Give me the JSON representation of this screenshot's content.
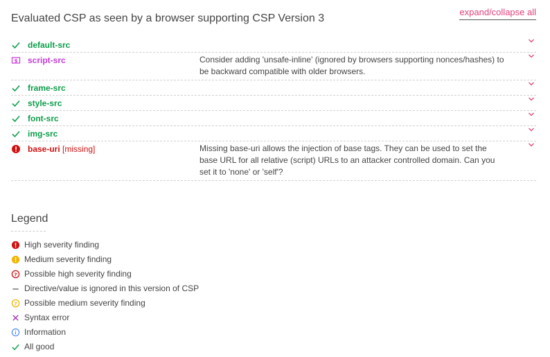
{
  "header": {
    "title": "Evaluated CSP as seen by a browser supporting CSP Version 3",
    "expand_label": "expand/collapse all"
  },
  "directives": [
    {
      "name": "default-src",
      "status": "ok",
      "missing": "",
      "description": ""
    },
    {
      "name": "script-src",
      "status": "info-purple",
      "missing": "",
      "description": "Consider adding 'unsafe-inline' (ignored by browsers supporting nonces/hashes) to be backward compatible with older browsers."
    },
    {
      "name": "frame-src",
      "status": "ok",
      "missing": "",
      "description": ""
    },
    {
      "name": "style-src",
      "status": "ok",
      "missing": "",
      "description": ""
    },
    {
      "name": "font-src",
      "status": "ok",
      "missing": "",
      "description": ""
    },
    {
      "name": "img-src",
      "status": "ok",
      "missing": "",
      "description": ""
    },
    {
      "name": "base-uri",
      "status": "high",
      "missing": "[missing]",
      "description": "Missing base-uri allows the injection of base tags. They can be used to set the base URL for all relative (script) URLs to an attacker controlled domain. Can you set it to 'none' or 'self'?"
    }
  ],
  "legend": {
    "title": "Legend",
    "items": [
      {
        "icon": "high-severity-icon",
        "label": "High severity finding"
      },
      {
        "icon": "medium-severity-icon",
        "label": "Medium severity finding"
      },
      {
        "icon": "possible-high-severity-icon",
        "label": "Possible high severity finding"
      },
      {
        "icon": "ignored-icon",
        "label": "Directive/value is ignored in this version of CSP"
      },
      {
        "icon": "possible-medium-severity-icon",
        "label": "Possible medium severity finding"
      },
      {
        "icon": "syntax-error-icon",
        "label": "Syntax error"
      },
      {
        "icon": "information-icon",
        "label": "Information"
      },
      {
        "icon": "all-good-icon",
        "label": "All good"
      }
    ]
  },
  "colors": {
    "ok": "#0c9d49",
    "purple": "#c43bd6",
    "red": "#d01111",
    "yellow": "#f4b400",
    "blue": "#4285f4",
    "link": "#e0417c"
  }
}
